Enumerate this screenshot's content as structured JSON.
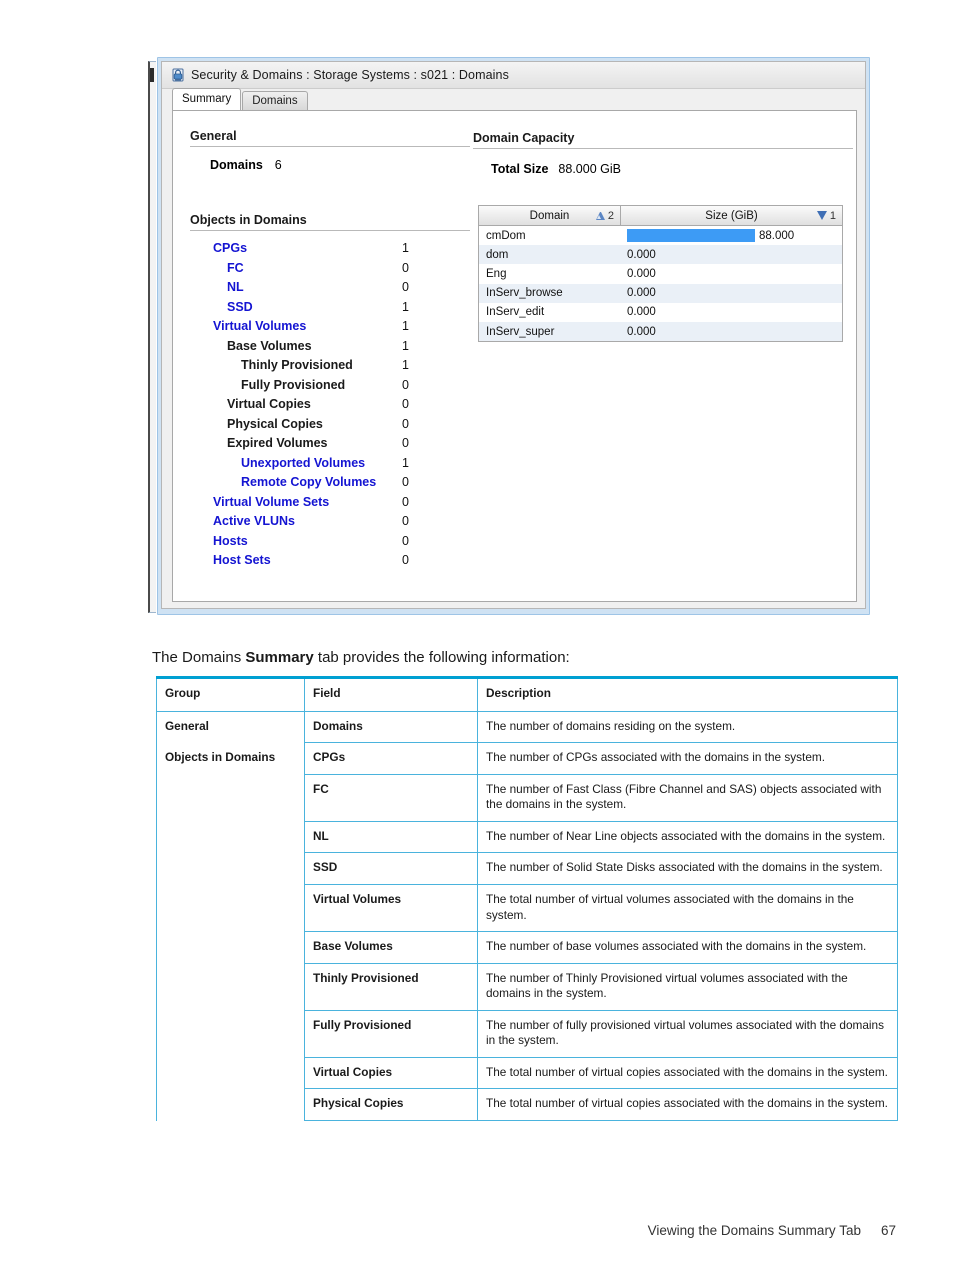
{
  "figure": {
    "window": {
      "icon": "security-lock-icon",
      "title": "Security & Domains : Storage Systems : s021 : Domains",
      "tabs": [
        {
          "label": "Summary",
          "active": true
        },
        {
          "label": "Domains",
          "active": false
        }
      ]
    },
    "general": {
      "section_title": "General",
      "domains_label": "Domains",
      "domains_value": "6"
    },
    "objects": {
      "section_title": "Objects in Domains",
      "rows": [
        {
          "label": "CPGs",
          "value": "1",
          "indent": 0,
          "link": true
        },
        {
          "label": "FC",
          "value": "0",
          "indent": 1,
          "link": true
        },
        {
          "label": "NL",
          "value": "0",
          "indent": 1,
          "link": true
        },
        {
          "label": "SSD",
          "value": "1",
          "indent": 1,
          "link": true
        },
        {
          "label": "Virtual Volumes",
          "value": "1",
          "indent": 0,
          "link": true
        },
        {
          "label": "Base Volumes",
          "value": "1",
          "indent": 1,
          "link": false
        },
        {
          "label": "Thinly Provisioned",
          "value": "1",
          "indent": 2,
          "link": false
        },
        {
          "label": "Fully Provisioned",
          "value": "0",
          "indent": 2,
          "link": false
        },
        {
          "label": "Virtual Copies",
          "value": "0",
          "indent": 1,
          "link": false
        },
        {
          "label": "Physical Copies",
          "value": "0",
          "indent": 1,
          "link": false
        },
        {
          "label": "Expired Volumes",
          "value": "0",
          "indent": 1,
          "link": false
        },
        {
          "label": "Unexported Volumes",
          "value": "1",
          "indent": 2,
          "link": true
        },
        {
          "label": "Remote Copy Volumes",
          "value": "0",
          "indent": 2,
          "link": true
        },
        {
          "label": "Virtual Volume Sets",
          "value": "0",
          "indent": 0,
          "link": true
        },
        {
          "label": "Active VLUNs",
          "value": "0",
          "indent": 0,
          "link": true
        },
        {
          "label": "Hosts",
          "value": "0",
          "indent": 0,
          "link": true
        },
        {
          "label": "Host Sets",
          "value": "0",
          "indent": 0,
          "link": true
        }
      ]
    },
    "capacity": {
      "section_title": "Domain Capacity",
      "total_size_label": "Total Size",
      "total_size_value": "88.000 GiB",
      "columns": [
        {
          "label": "Domain",
          "sort": "asc",
          "sort_order": "2"
        },
        {
          "label": "Size (GiB)",
          "sort": "desc",
          "sort_order": "1"
        }
      ],
      "bar_color": "#3d9bf5",
      "rows": [
        {
          "domain": "cmDom",
          "size": "88.000",
          "bar_pct": 100
        },
        {
          "domain": "dom",
          "size": "0.000",
          "bar_pct": 0
        },
        {
          "domain": "Eng",
          "size": "0.000",
          "bar_pct": 0
        },
        {
          "domain": "InServ_browse",
          "size": "0.000",
          "bar_pct": 0
        },
        {
          "domain": "InServ_edit",
          "size": "0.000",
          "bar_pct": 0
        },
        {
          "domain": "InServ_super",
          "size": "0.000",
          "bar_pct": 0
        }
      ]
    }
  },
  "body": {
    "intro_before": "The Domains ",
    "intro_bold": "Summary",
    "intro_after": " tab provides the following information:",
    "table": {
      "headers": [
        "Group",
        "Field",
        "Description"
      ],
      "rows": [
        {
          "group": "General",
          "field": "Domains",
          "description": "The number of domains residing on the system."
        },
        {
          "group": "Objects in Domains",
          "field": "CPGs",
          "description": "The number of CPGs associated with the domains in the system."
        },
        {
          "group": "",
          "field": "FC",
          "description": "The number of Fast Class (Fibre Channel and SAS) objects associated with the domains in the system."
        },
        {
          "group": "",
          "field": "NL",
          "description": "The number of Near Line objects associated with the domains in the system."
        },
        {
          "group": "",
          "field": "SSD",
          "description": "The number of Solid State Disks associated with the domains in the system."
        },
        {
          "group": "",
          "field": "Virtual Volumes",
          "description": "The total number of virtual volumes associated with the domains in the system."
        },
        {
          "group": "",
          "field": "Base Volumes",
          "description": "The number of base volumes associated with the domains in the system."
        },
        {
          "group": "",
          "field": "Thinly Provisioned",
          "description": "The number of Thinly Provisioned virtual volumes associated with the domains in the system."
        },
        {
          "group": "",
          "field": "Fully Provisioned",
          "description": "The number of fully provisioned virtual volumes associated with the domains in the system."
        },
        {
          "group": "",
          "field": "Virtual Copies",
          "description": "The total number of virtual copies associated with the domains in the system."
        },
        {
          "group": "",
          "field": "Physical Copies",
          "description": "The total number of virtual copies associated with the domains in the system."
        }
      ]
    }
  },
  "footer": {
    "running_head": "Viewing the Domains Summary Tab",
    "page_number": "67"
  }
}
